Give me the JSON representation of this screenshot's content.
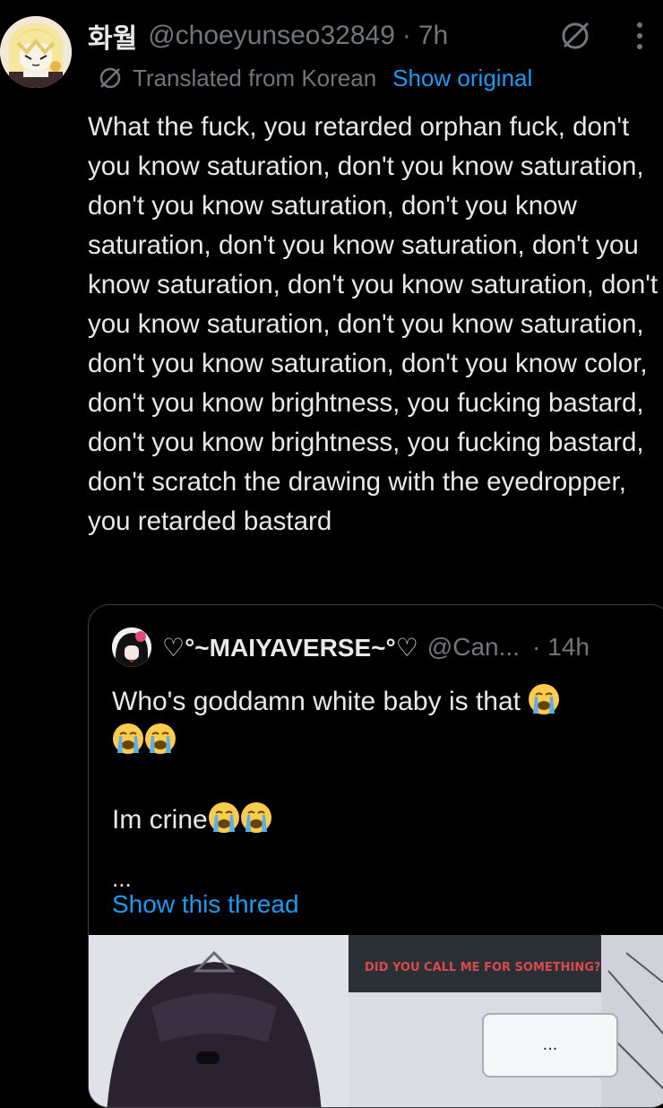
{
  "tweet": {
    "author_name": "화월",
    "author_handle": "@choeyunseo32849",
    "separator": "·",
    "time": "7h",
    "translated_label": "Translated from Korean",
    "show_original_label": "Show original",
    "text": "What the fuck, you retarded orphan fuck, don't you know saturation, don't you know saturation, don't you know saturation, don't you know saturation, don't you know saturation, don't you know saturation, don't you know saturation, don't you know saturation, don't you know saturation, don't you know saturation, don't you know color, don't you know brightness, you fucking bastard, don't you know brightness, you fucking bastard, don't scratch the drawing with the eyedropper, you retarded bastard",
    "icons": [
      "avatar",
      "translate-icon",
      "more-icon"
    ]
  },
  "quote": {
    "author_name": "♡°~MAIYAVERSE~°♡",
    "author_handle": "@Can...",
    "separator": "·",
    "time": "14h",
    "line1": "Who's goddamn white baby is that",
    "line3": "Im crine",
    "more": "...",
    "show_thread_label": "Show this thread",
    "image_caption": "DID YOU CALL ME FOR SOMETHING?",
    "speech_bubble_text": "...",
    "emoji": "loudly-crying-face"
  },
  "colors": {
    "background": "#000000",
    "text": "#e7e9ea",
    "secondary": "#71767b",
    "link": "#1d9bf0",
    "border": "#3a3d41"
  }
}
